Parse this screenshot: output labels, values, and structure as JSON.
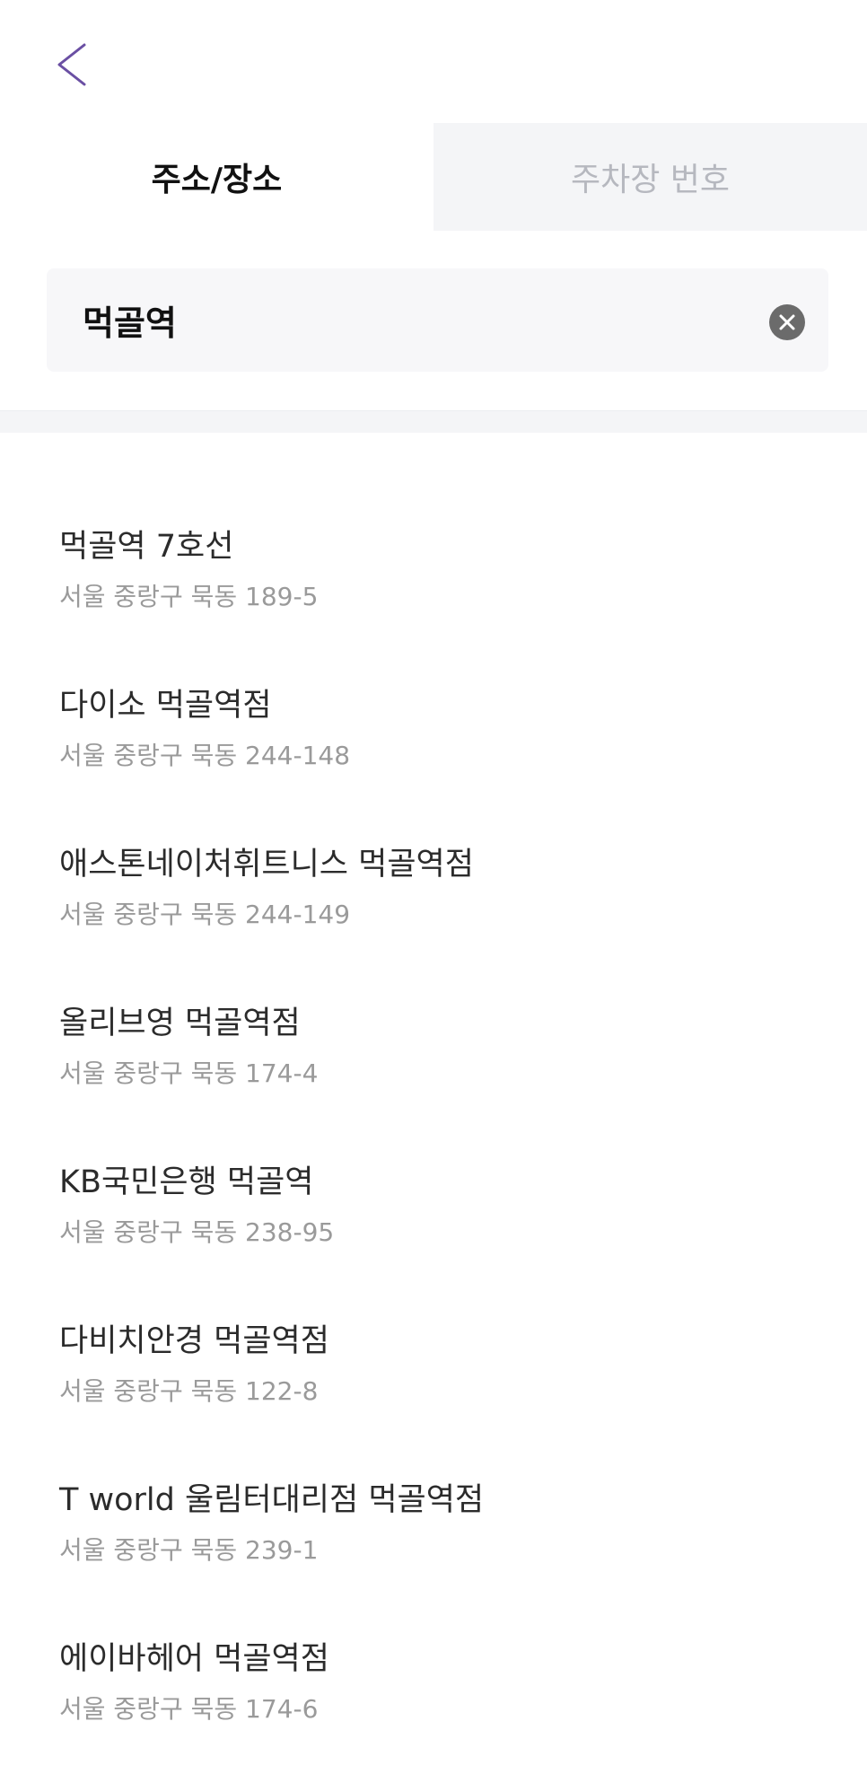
{
  "header": {
    "back_icon": "chevron-left-icon",
    "accent_color": "#6a4fa3"
  },
  "tabs": [
    {
      "label": "주소/장소",
      "active": true
    },
    {
      "label": "주차장 번호",
      "active": false
    }
  ],
  "search": {
    "value": "먹골역",
    "clear_icon": "close-circle-icon"
  },
  "results": [
    {
      "title": "먹골역 7호선",
      "address": "서울 중랑구 묵동 189-5"
    },
    {
      "title": "다이소 먹골역점",
      "address": "서울 중랑구 묵동 244-148"
    },
    {
      "title": "애스톤네이처휘트니스 먹골역점",
      "address": "서울 중랑구 묵동 244-149"
    },
    {
      "title": "올리브영 먹골역점",
      "address": "서울 중랑구 묵동 174-4"
    },
    {
      "title": "KB국민은행 먹골역",
      "address": "서울 중랑구 묵동 238-95"
    },
    {
      "title": "다비치안경 먹골역점",
      "address": "서울 중랑구 묵동 122-8"
    },
    {
      "title": "T world 울림터대리점 먹골역점",
      "address": "서울 중랑구 묵동 239-1"
    },
    {
      "title": "에이바헤어 먹골역점",
      "address": "서울 중랑구 묵동 174-6"
    }
  ]
}
